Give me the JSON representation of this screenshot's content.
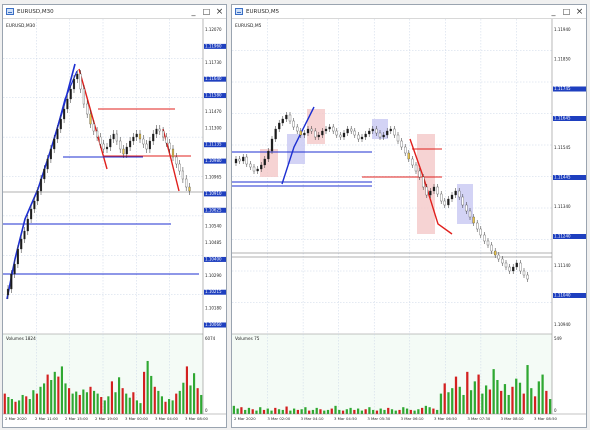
{
  "windows": [
    {
      "title": "EURUSD,M30",
      "symbol": "EURUSD,M30",
      "controls": [
        "_",
        "□",
        "×"
      ],
      "price_labels": [
        "1.12070",
        "1.11960",
        "1.11730",
        "1.11640",
        "1.11580",
        "1.11470",
        "1.11300",
        "1.11135",
        "1.10980",
        "1.10965",
        "1.10910",
        "1.10625",
        "1.10540",
        "1.10485",
        "1.10400",
        "1.10290",
        "1.10215",
        "1.10180",
        "1.10060"
      ],
      "volume_label": "Volumes 1824",
      "volume_scale": "6074",
      "volume_zero": "0",
      "time_labels": [
        "2 Mar 2020",
        "2 Mar 11:00",
        "2 Mar 15:00",
        "2 Mar 19:00",
        "3 Mar 00:00",
        "3 Mar 04:00",
        "3 Mar 08:00"
      ],
      "volumes": [
        0.3,
        0.25,
        0.22,
        0.18,
        0.2,
        0.28,
        0.26,
        0.22,
        0.35,
        0.3,
        0.4,
        0.45,
        0.58,
        0.5,
        0.62,
        0.55,
        0.7,
        0.45,
        0.38,
        0.3,
        0.33,
        0.28,
        0.36,
        0.32,
        0.4,
        0.34,
        0.3,
        0.25,
        0.2,
        0.26,
        0.48,
        0.32,
        0.54,
        0.38,
        0.3,
        0.24,
        0.32,
        0.2,
        0.16,
        0.62,
        0.78,
        0.56,
        0.4,
        0.34,
        0.26,
        0.18,
        0.22,
        0.2,
        0.3,
        0.34,
        0.46,
        0.7,
        0.42,
        0.6,
        0.38,
        0.28
      ]
    },
    {
      "title": "EURUSD,M5",
      "symbol": "EURUSD,M5",
      "controls": [
        "_",
        "□",
        "×"
      ],
      "price_labels": [
        "1.11940",
        "1.11850",
        "1.11745",
        "1.11645",
        "1.11545",
        "1.11445",
        "1.11340",
        "1.11240",
        "1.11140",
        "1.11040",
        "1.10940"
      ],
      "volume_label": "Volumes 75",
      "volume_scale": "549",
      "volume_zero": "0",
      "time_labels": [
        "2 Mar 2020",
        "3 Mar 02:00",
        "3 Mar 04:10",
        "3 Mar 04:50",
        "3 Mar 05:30",
        "3 Mar 06:10",
        "3 Mar 06:50",
        "3 Mar 07:30",
        "3 Mar 08:10",
        "3 Mar 08:50"
      ],
      "volumes": [
        0.12,
        0.08,
        0.1,
        0.06,
        0.09,
        0.07,
        0.05,
        0.1,
        0.06,
        0.08,
        0.05,
        0.09,
        0.07,
        0.06,
        0.11,
        0.05,
        0.08,
        0.06,
        0.07,
        0.1,
        0.05,
        0.06,
        0.09,
        0.07,
        0.05,
        0.06,
        0.08,
        0.12,
        0.06,
        0.05,
        0.07,
        0.09,
        0.06,
        0.08,
        0.05,
        0.07,
        0.1,
        0.06,
        0.05,
        0.08,
        0.06,
        0.09,
        0.07,
        0.05,
        0.06,
        0.1,
        0.08,
        0.06,
        0.05,
        0.07,
        0.09,
        0.12,
        0.1,
        0.08,
        0.06,
        0.3,
        0.45,
        0.32,
        0.38,
        0.55,
        0.4,
        0.28,
        0.62,
        0.35,
        0.48,
        0.58,
        0.3,
        0.42,
        0.36,
        0.66,
        0.5,
        0.34,
        0.44,
        0.28,
        0.4,
        0.52,
        0.46,
        0.3,
        0.72,
        0.38,
        0.26,
        0.48,
        0.58,
        0.34,
        0.22
      ]
    }
  ],
  "colors": {
    "chart_bg": "#ffffff",
    "volume_bg": "#f4fbf6",
    "grid": "#c8d4e6",
    "uptrend": "#1d2fd1",
    "downtrend": "#e0201d",
    "volume_bar_up": "#2fa832",
    "volume_bar_down": "#d32020",
    "price_tag": "#1e3fbf",
    "buy_zone": "#c8c8f2",
    "sell_zone": "#f4c8c8"
  }
}
